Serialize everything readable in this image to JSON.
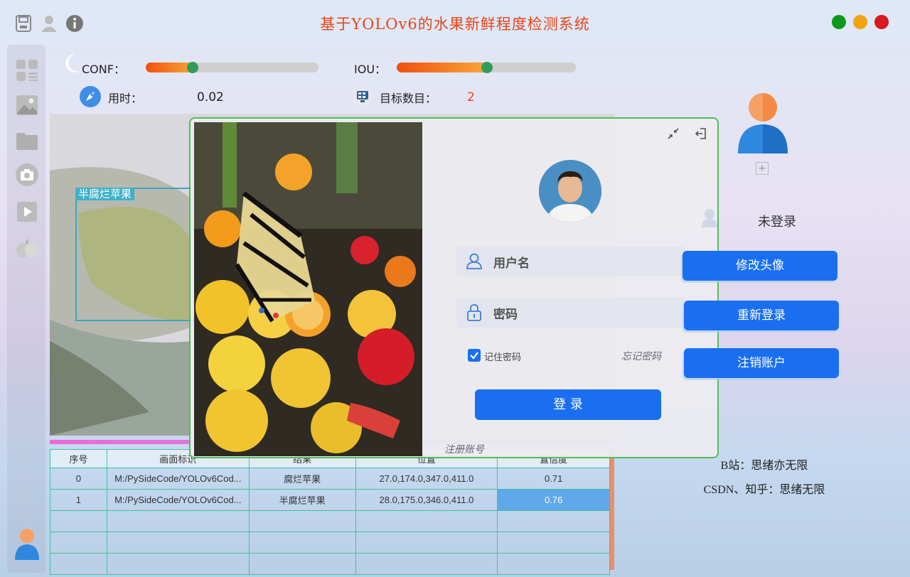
{
  "app": {
    "title": "基于YOLOv6的水果新鲜程度检测系统"
  },
  "window_buttons": {
    "green": "#0c9a1a",
    "yellow": "#f0a412",
    "red": "#d9181f"
  },
  "toolbar_icons": [
    "save-icon",
    "user-icon",
    "info-icon"
  ],
  "sidebar_icons": [
    "dashboard-icon",
    "image-icon",
    "folder-icon",
    "camera-icon",
    "video-play-icon",
    "garlic-icon",
    "avatar-icon"
  ],
  "params": {
    "conf_label": "CONF：",
    "conf_value": 0.27,
    "iou_label": "IOU：",
    "iou_value": 0.5,
    "time_label": "用时：",
    "time_value": "0.02",
    "count_label": "目标数目：",
    "count_value": "2"
  },
  "detection": {
    "box_label": "半腐烂苹果"
  },
  "table": {
    "headers": [
      "序号",
      "画面标识",
      "结果",
      "位置",
      "置信度"
    ],
    "rows": [
      [
        "0",
        "M:/PySideCode/YOLOv6Cod...",
        "腐烂苹果",
        "27.0,174.0,347.0,411.0",
        "0.71"
      ],
      [
        "1",
        "M:/PySideCode/YOLOv6Cod...",
        "半腐烂苹果",
        "28.0,175.0,346.0,411.0",
        "0.76"
      ]
    ],
    "empty_rows": 3
  },
  "login": {
    "username_placeholder": "用户名",
    "password_placeholder": "密码",
    "remember_label": "记住密码",
    "remember_checked": true,
    "forgot_label": "忘记密码",
    "login_button": "登 录",
    "register_link": "注册账号",
    "accent": "#1a6ff0",
    "border": "#4fbf5a"
  },
  "user_panel": {
    "status": "未登录",
    "add_label": "+",
    "buttons": [
      "修改头像",
      "重新登录",
      "注销账户"
    ]
  },
  "credits": {
    "line1": "B站：思绪亦无限",
    "line2": "CSDN、知乎：思绪无限"
  }
}
